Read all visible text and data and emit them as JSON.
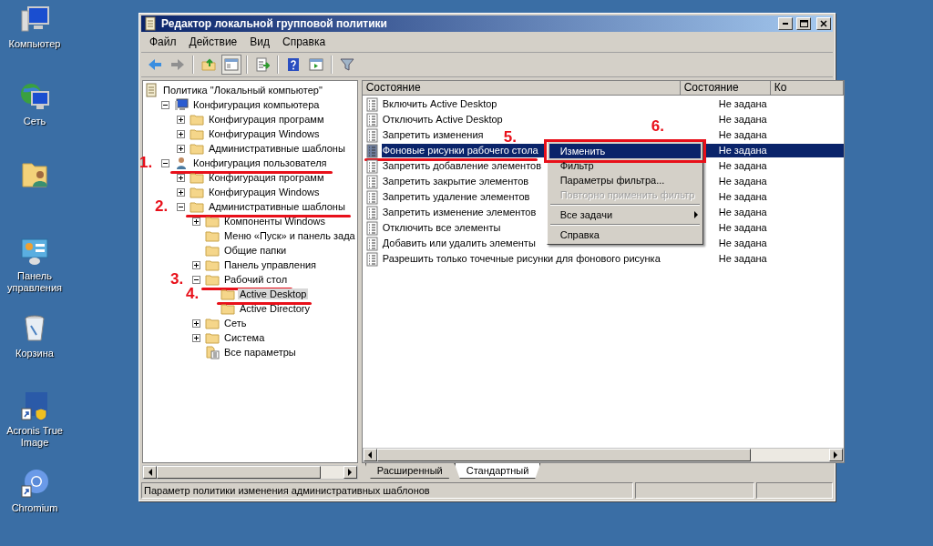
{
  "desktop_icons": [
    {
      "kind": "computer",
      "label": "Компьютер"
    },
    {
      "kind": "network",
      "label": "Сеть"
    },
    {
      "kind": "user-folder"
    },
    {
      "kind": "control-panel",
      "label": "Панель управления"
    },
    {
      "kind": "recycle-bin",
      "label": "Корзина"
    },
    {
      "kind": "acronis",
      "label": "Acronis True Image"
    },
    {
      "kind": "chromium",
      "label": "Chromium"
    }
  ],
  "window": {
    "title": "Редактор локальной групповой политики",
    "menu": [
      "Файл",
      "Действие",
      "Вид",
      "Справка"
    ],
    "toolbar": [
      {
        "kind": "back"
      },
      {
        "kind": "forward"
      },
      {
        "kind": "sep"
      },
      {
        "kind": "up"
      },
      {
        "kind": "pane",
        "selected": true
      },
      {
        "kind": "sep"
      },
      {
        "kind": "export"
      },
      {
        "kind": "sep"
      },
      {
        "kind": "help"
      },
      {
        "kind": "pane2"
      },
      {
        "kind": "sep"
      },
      {
        "kind": "filter"
      }
    ],
    "tree": [
      {
        "label": "Политика \"Локальный компьютер\"",
        "kind": "policy",
        "selected": false,
        "children": [
          {
            "label": "Конфигурация компьютера",
            "kind": "computer",
            "expanded": true,
            "selected": false,
            "children": [
              {
                "label": "Конфигурация программ",
                "kind": "folder",
                "expanded": false,
                "selected": false
              },
              {
                "label": "Конфигурация Windows",
                "kind": "folder",
                "expanded": false,
                "selected": false
              },
              {
                "label": "Административные шаблоны",
                "kind": "folder",
                "expanded": false,
                "selected": false
              }
            ]
          },
          {
            "label": "Конфигурация пользователя",
            "kind": "user",
            "expanded": true,
            "selected": false,
            "annotation": "1.",
            "underlined": true,
            "children": [
              {
                "label": "Конфигурация программ",
                "kind": "folder",
                "expanded": false,
                "selected": false
              },
              {
                "label": "Конфигурация Windows",
                "kind": "folder",
                "expanded": false,
                "selected": false
              },
              {
                "label": "Административные шаблоны",
                "kind": "folder",
                "expanded": true,
                "selected": false,
                "annotation": "2.",
                "underlined": true,
                "children": [
                  {
                    "label": "Компоненты Windows",
                    "kind": "folder",
                    "expanded": false,
                    "selected": false
                  },
                  {
                    "label": "Меню «Пуск» и панель зада",
                    "kind": "folder",
                    "selected": false
                  },
                  {
                    "label": "Общие папки",
                    "kind": "folder",
                    "selected": false
                  },
                  {
                    "label": "Панель управления",
                    "kind": "folder",
                    "expanded": false,
                    "selected": false
                  },
                  {
                    "label": "Рабочий стол",
                    "kind": "folder",
                    "expanded": true,
                    "selected": false,
                    "annotation": "3.",
                    "underlined": true,
                    "children": [
                      {
                        "label": "Active Desktop",
                        "kind": "folder",
                        "selected": true,
                        "annotation": "4.",
                        "underlined": true
                      },
                      {
                        "label": "Active Directory",
                        "kind": "folder",
                        "selected": false
                      }
                    ]
                  },
                  {
                    "label": "Сеть",
                    "kind": "folder",
                    "expanded": false,
                    "selected": false
                  },
                  {
                    "label": "Система",
                    "kind": "folder",
                    "expanded": false,
                    "selected": false
                  },
                  {
                    "label": "Все параметры",
                    "kind": "settings-list",
                    "selected": false
                  }
                ]
              }
            ]
          }
        ]
      }
    ],
    "columns": [
      "Состояние",
      "Состояние",
      "Ко"
    ],
    "rows": [
      {
        "name": "Включить Active Desktop",
        "state": "Не задана",
        "selected": false
      },
      {
        "name": "Отключить Active Desktop",
        "state": "Не задана",
        "selected": false
      },
      {
        "name": "Запретить изменения",
        "state": "Не задана",
        "selected": false
      },
      {
        "name": "Фоновые рисунки рабочего стола",
        "state": "Не задана",
        "selected": true,
        "annotation": "5.",
        "underlined": true
      },
      {
        "name": "Запретить добавление элементов",
        "state": "Не задана",
        "selected": false
      },
      {
        "name": "Запретить закрытие элементов",
        "state": "Не задана",
        "selected": false
      },
      {
        "name": "Запретить удаление элементов",
        "state": "Не задана",
        "selected": false
      },
      {
        "name": "Запретить изменение элементов",
        "state": "Не задана",
        "selected": false
      },
      {
        "name": "Отключить все элементы",
        "state": "Не задана",
        "selected": false
      },
      {
        "name": "Добавить или удалить элементы",
        "state": "Не задана",
        "selected": false
      },
      {
        "name": "Разрешить только точечные рисунки для фонового рисунка",
        "state": "Не задана",
        "selected": false
      }
    ],
    "context_menu": [
      {
        "kind": "item",
        "label": "Изменить",
        "selected": true,
        "disabled": false,
        "annotation": "6.",
        "boxed": true
      },
      {
        "kind": "item",
        "label": "Фильтр",
        "selected": false,
        "disabled": false
      },
      {
        "kind": "item",
        "label": "Параметры фильтра...",
        "selected": false,
        "disabled": false
      },
      {
        "kind": "item",
        "label": "Повторно применить фильтр",
        "selected": false,
        "disabled": true
      },
      {
        "kind": "separator"
      },
      {
        "kind": "submenu",
        "label": "Все задачи",
        "selected": false,
        "disabled": false
      },
      {
        "kind": "separator"
      },
      {
        "kind": "item",
        "label": "Справка",
        "selected": false,
        "disabled": false
      }
    ],
    "tabs": [
      {
        "label": "Расширенный",
        "selected": false
      },
      {
        "label": "Стандартный",
        "selected": true
      }
    ],
    "status_bar": "Параметр политики изменения административных шаблонов"
  }
}
